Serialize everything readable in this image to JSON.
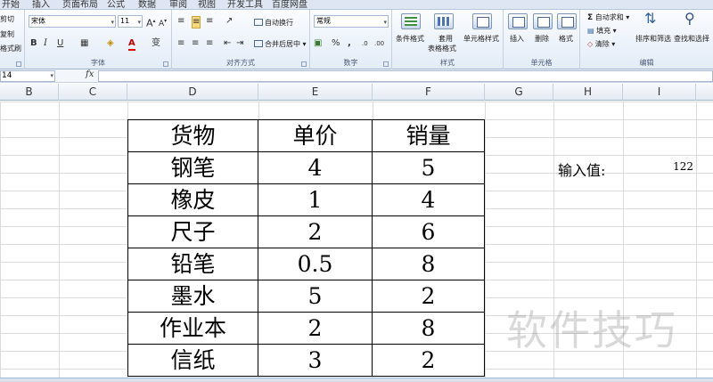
{
  "ribbon": {
    "tabs": [
      "开始",
      "插入",
      "页面布局",
      "公式",
      "数据",
      "审阅",
      "视图",
      "开发工具",
      "百度网盘"
    ],
    "clipboard": {
      "cut": "剪切",
      "copy": "复制",
      "format_painter": "格式刷"
    },
    "font": {
      "name": "宋体",
      "size": "11",
      "group_label": "字体",
      "bold": "B",
      "italic": "I",
      "underline": "U",
      "font_color": "A"
    },
    "alignment": {
      "wrap_text": "自动换行",
      "merge_center": "合并后居中",
      "group_label": "对齐方式"
    },
    "number": {
      "format": "常规",
      "percent": "%",
      "comma": ",",
      "group_label": "数字"
    },
    "styles": {
      "conditional": "条件格式",
      "table_format_line1": "套用",
      "table_format_line2": "表格格式",
      "cell_styles": "单元格样式",
      "group_label": "样式"
    },
    "cells": {
      "insert": "插入",
      "delete": "删除",
      "format": "格式",
      "group_label": "单元格"
    },
    "editing": {
      "autosum": "自动求和",
      "fill": "填充",
      "clear": "清除",
      "sort_filter": "排序和筛选",
      "find_select": "查找和选择",
      "group_label": "编辑"
    }
  },
  "formula_bar": {
    "name_box": "14",
    "fx": "fx",
    "value": ""
  },
  "columns": [
    "B",
    "C",
    "D",
    "E",
    "F",
    "G",
    "H",
    "I"
  ],
  "table": {
    "headers": [
      "货物",
      "单价",
      "销量"
    ],
    "rows": [
      [
        "钢笔",
        "4",
        "5"
      ],
      [
        "橡皮",
        "1",
        "4"
      ],
      [
        "尺子",
        "2",
        "6"
      ],
      [
        "铅笔",
        "0.5",
        "8"
      ],
      [
        "墨水",
        "5",
        "2"
      ],
      [
        "作业本",
        "2",
        "8"
      ],
      [
        "信纸",
        "3",
        "2"
      ]
    ]
  },
  "input": {
    "label": "输入值:",
    "value": "122"
  },
  "watermark": "软件技巧"
}
